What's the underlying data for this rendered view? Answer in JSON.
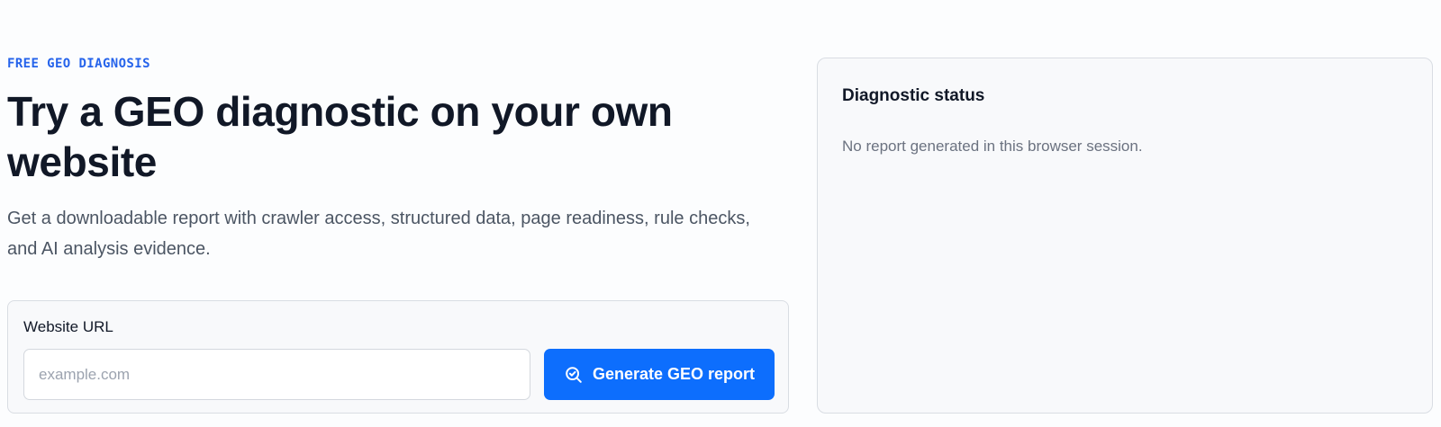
{
  "hero": {
    "eyebrow": "FREE GEO DIAGNOSIS",
    "title": "Try a GEO diagnostic on your own website",
    "description": "Get a downloadable report with crawler access, structured data, page readiness, rule checks, and AI analysis evidence."
  },
  "form": {
    "label": "Website URL",
    "url_value": "",
    "url_placeholder": "example.com",
    "submit_label": "Generate GEO report",
    "submit_icon": "search-check-icon"
  },
  "status": {
    "title": "Diagnostic status",
    "message": "No report generated in this browser session."
  },
  "colors": {
    "accent": "#0d6efd",
    "eyebrow": "#2563eb",
    "card_background": "#f8f9fb",
    "border": "#d9dde3"
  }
}
